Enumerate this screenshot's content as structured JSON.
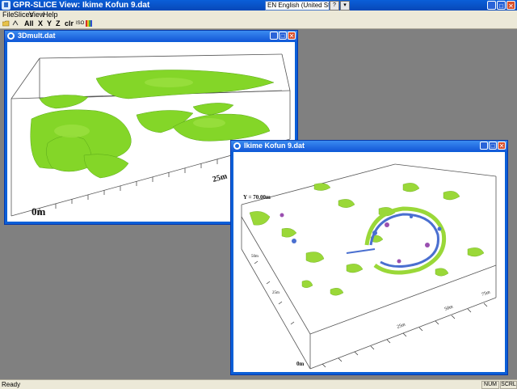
{
  "app": {
    "title": "GPR-SLICE View:   Ikime Kofun 9.dat",
    "language": "EN English (United States)",
    "language_button": "?",
    "language_dropdown": "▾",
    "minimize": "_",
    "maximize": "□",
    "close": "✕"
  },
  "menu": [
    "File",
    "Slices",
    "View",
    "Help"
  ],
  "toolbar": {
    "buttons": [
      "All",
      "X",
      "Y",
      "Z",
      "clr",
      "ISO"
    ]
  },
  "windows": [
    {
      "title": "3Dmult.dat",
      "labels": {
        "origin": "0m",
        "scale": "25m"
      }
    },
    {
      "title": "Ikime Kofun 9.dat",
      "labels": {
        "slice": "Y = 70.00m",
        "origin": "0m",
        "tick_a": "25m",
        "tick_b": "50m",
        "tick_c": "75m",
        "tick_d": "50m",
        "tick_e": "25m"
      }
    }
  ],
  "status": {
    "text": "Ready",
    "num": "NUM",
    "scrl": "SCRL"
  },
  "colors": {
    "titlebar": "#0a5fd8",
    "iso_green": "#7ed321",
    "anomaly_blue": "#4a6fd0",
    "anomaly_purple": "#9a4fb0"
  }
}
